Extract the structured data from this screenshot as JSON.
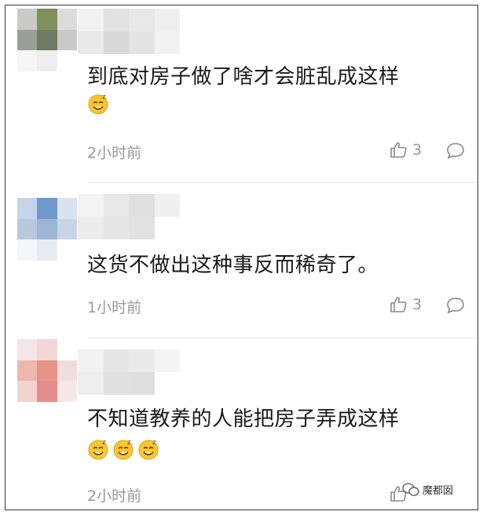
{
  "comments": [
    {
      "text": "到底对房子做了啥才会脏乱成这样",
      "time": "2小时前",
      "likes": "3",
      "emoji_count": 1
    },
    {
      "text": "这货不做出这种事反而稀奇了。",
      "time": "1小时前",
      "likes": "3",
      "emoji_count": 0
    },
    {
      "text": "不知道教养的人能把房子弄成这样",
      "time": "2小时前",
      "likes": "",
      "emoji_count": 3
    }
  ],
  "watermark": {
    "label": "魔都囡"
  },
  "icons": {
    "like": "thumbs-up-icon",
    "reply": "comment-bubble-icon",
    "emoji": "sleepy-smile-emoji"
  }
}
